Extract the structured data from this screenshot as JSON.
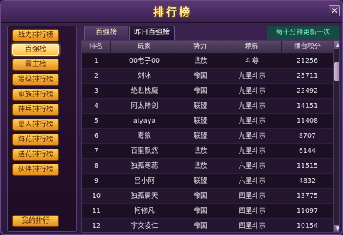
{
  "window": {
    "title": "排行榜",
    "close_label": "✕"
  },
  "sidebar": {
    "items": [
      {
        "label": "战力排行榜",
        "active": false
      },
      {
        "label": "百强榜",
        "active": true
      },
      {
        "label": "霸主榜",
        "active": false
      },
      {
        "label": "等级排行榜",
        "active": false
      },
      {
        "label": "家族排行榜",
        "active": false
      },
      {
        "label": "神兵排行榜",
        "active": false
      },
      {
        "label": "恶人排行榜",
        "active": false
      },
      {
        "label": "鲜花排行榜",
        "active": false
      },
      {
        "label": "送花排行榜",
        "active": false
      },
      {
        "label": "伙伴排行榜",
        "active": false
      }
    ],
    "my_rank_label": "我的排行"
  },
  "tabs": [
    {
      "label": "百强榜",
      "active": false
    },
    {
      "label": "昨日百强榜",
      "active": true
    }
  ],
  "update_note": "每十分钟更新一次",
  "table": {
    "headers": [
      "排名",
      "玩家",
      "势力",
      "境界",
      "播台积分"
    ],
    "rows": [
      [
        "1",
        "00老子00",
        "世族",
        "斗尊",
        "21256"
      ],
      [
        "2",
        "刘冰",
        "帝国",
        "九星斗宗",
        "25711"
      ],
      [
        "3",
        "绝世枕魔",
        "帝国",
        "九星斗宗",
        "22492"
      ],
      [
        "4",
        "阿太神剑",
        "联盟",
        "九星斗宗",
        "14151"
      ],
      [
        "5",
        "aiyaya",
        "联盟",
        "九星斗宗",
        "11408"
      ],
      [
        "6",
        "毒狼",
        "联盟",
        "九星斗宗",
        "8707"
      ],
      [
        "7",
        "百里飘然",
        "世族",
        "九星斗宗",
        "6144"
      ],
      [
        "8",
        "独孤寒蕊",
        "世族",
        "六星斗宗",
        "11515"
      ],
      [
        "9",
        "吕小阿",
        "联盟",
        "六星斗宗",
        "4832"
      ],
      [
        "10",
        "独孤霸天",
        "帝国",
        "四星斗宗",
        "13775"
      ],
      [
        "11",
        "柯修凡",
        "帝国",
        "四星斗宗",
        "11097"
      ],
      [
        "12",
        "宇文凌仁",
        "帝国",
        "四星斗宗",
        "10154"
      ]
    ]
  },
  "scrollbar": {
    "up_icon": "▲",
    "down_icon": "▼",
    "position": 0.08
  }
}
